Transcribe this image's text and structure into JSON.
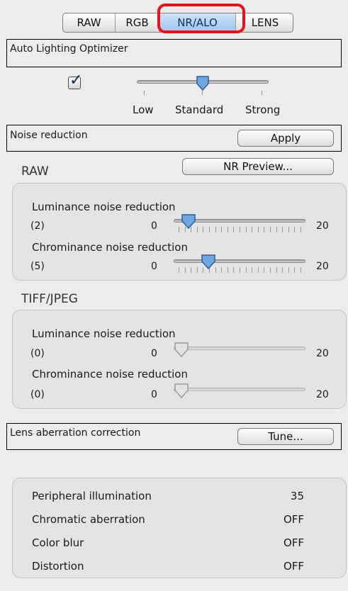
{
  "tabs": [
    {
      "label": "RAW",
      "active": false
    },
    {
      "label": "RGB",
      "active": false
    },
    {
      "label": "NR/ALO",
      "active": true
    },
    {
      "label": "LENS",
      "active": false
    }
  ],
  "alo": {
    "title": "Auto Lighting Optimizer",
    "checked": true,
    "levels": [
      "Low",
      "Standard",
      "Strong"
    ],
    "selected_level": "Standard"
  },
  "noise": {
    "title": "Noise reduction",
    "apply_label": "Apply",
    "preview_label": "NR Preview..."
  },
  "raw": {
    "title": "RAW",
    "luminance": {
      "label": "Luminance noise reduction",
      "value_text": "(2)",
      "min": "0",
      "max": "20",
      "value": 2
    },
    "chrominance": {
      "label": "Chrominance noise reduction",
      "value_text": "(5)",
      "min": "0",
      "max": "20",
      "value": 5
    }
  },
  "tiff": {
    "title": "TIFF/JPEG",
    "luminance": {
      "label": "Luminance noise reduction",
      "value_text": "(0)",
      "min": "0",
      "max": "20",
      "value": 0
    },
    "chrominance": {
      "label": "Chrominance noise reduction",
      "value_text": "(0)",
      "min": "0",
      "max": "20",
      "value": 0
    }
  },
  "lens": {
    "title": "Lens aberration correction",
    "tune_label": "Tune...",
    "rows": [
      {
        "label": "Peripheral illumination",
        "value": "35"
      },
      {
        "label": "Chromatic aberration",
        "value": "OFF"
      },
      {
        "label": "Color blur",
        "value": "OFF"
      },
      {
        "label": "Distortion",
        "value": "OFF"
      }
    ]
  },
  "colors": {
    "highlight": "#e8121b",
    "active_tab": "#9cc6ee",
    "thumb": "#6fa6e0"
  }
}
